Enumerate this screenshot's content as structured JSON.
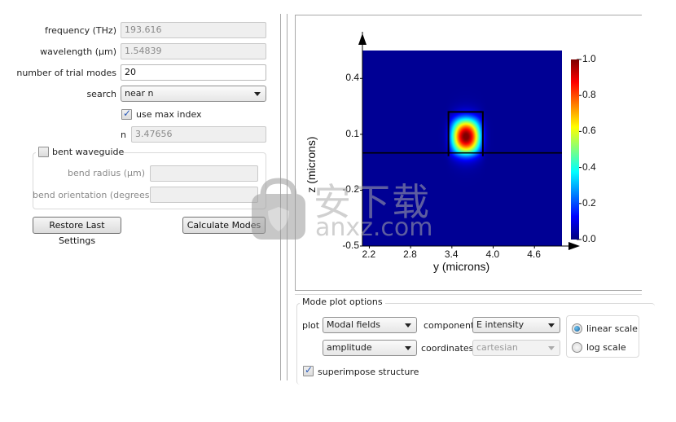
{
  "settings": {
    "frequency": {
      "label": "frequency (THz)",
      "value": "193.616",
      "disabled": true
    },
    "wavelength": {
      "label": "wavelength (µm)",
      "value": "1.54839",
      "disabled": true
    },
    "trial_modes": {
      "label": "number of trial modes",
      "value": "20"
    },
    "search": {
      "label": "search",
      "value": "near n"
    },
    "use_max_index": {
      "label": "use max index",
      "checked": true
    },
    "n": {
      "label": "n",
      "value": "3.47656",
      "disabled": true
    },
    "bent_waveguide": {
      "label": "bent waveguide",
      "checked": false,
      "bend_radius": {
        "label": "bend radius (µm)",
        "value": ""
      },
      "bend_orientation": {
        "label": "bend orientation (degrees)",
        "value": ""
      }
    },
    "restore_button": "Restore Last Settings",
    "calculate_button": "Calculate Modes"
  },
  "chart_data": {
    "type": "heatmap",
    "title": "",
    "xlabel": "y (microns)",
    "ylabel": "z (microns)",
    "x_ticks": [
      "2.2",
      "2.8",
      "3.4",
      "4.0",
      "4.6"
    ],
    "y_ticks": [
      "0.4",
      "0.1",
      "-0.2",
      "-0.5"
    ],
    "xlim": [
      2.1,
      5.0
    ],
    "ylim": [
      -0.5,
      0.55
    ],
    "colorbar": {
      "ticks": [
        "1.0",
        "0.8",
        "0.6",
        "0.4",
        "0.2",
        "0.0"
      ],
      "range": [
        0.0,
        1.0
      ],
      "colormap": "jet"
    },
    "mode_peak": {
      "y": 3.6,
      "z": 0.09,
      "value": 1.0
    },
    "waveguide_core": {
      "y_range": [
        3.35,
        3.85
      ],
      "z_range": [
        0.0,
        0.22
      ]
    },
    "substrate_interface_z": 0.0
  },
  "plot_options": {
    "title": "Mode plot options",
    "plot_label": "plot",
    "plot_value": "Modal fields",
    "part_value": "amplitude",
    "component_label": "component",
    "component_value": "E intensity",
    "coordinates_label": "coordinates",
    "coordinates_value": "cartesian",
    "linear_scale": {
      "label": "linear scale",
      "selected": true
    },
    "log_scale": {
      "label": "log scale",
      "selected": false
    },
    "superimpose": {
      "label": "superimpose structure",
      "checked": true
    }
  },
  "watermark": {
    "text_cn": "安下载",
    "text_en": "anxz.com"
  }
}
